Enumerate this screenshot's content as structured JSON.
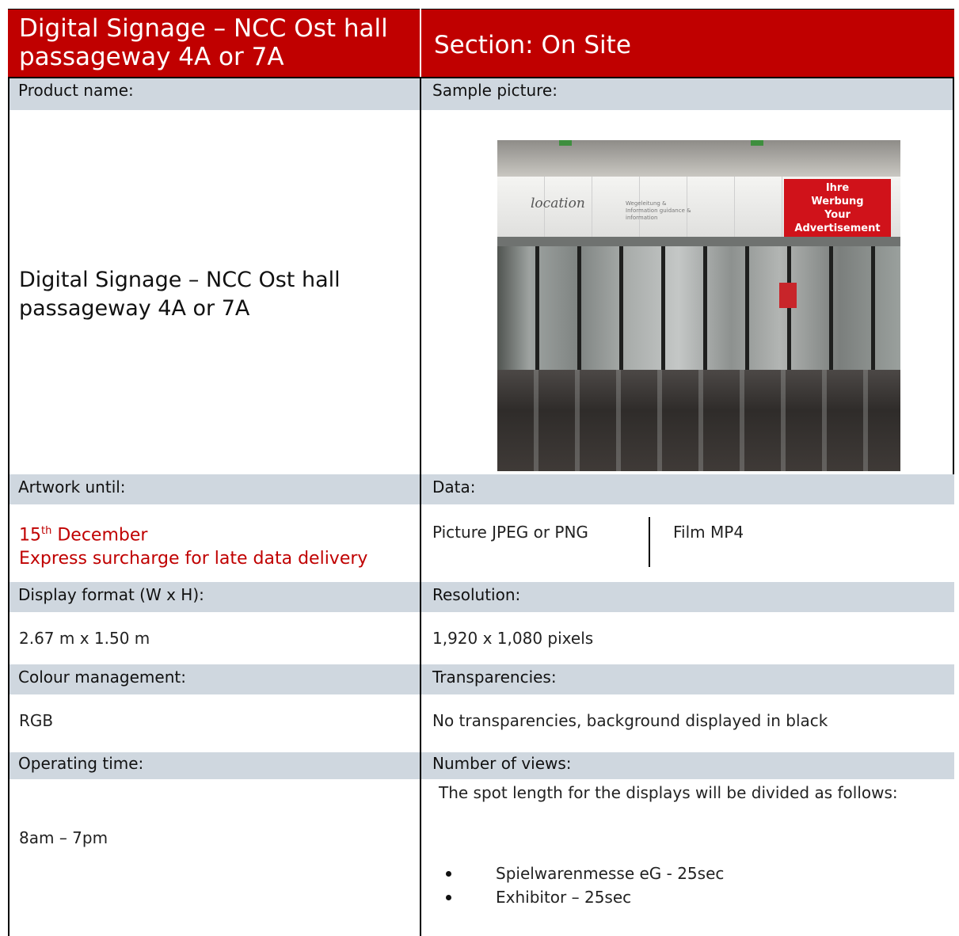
{
  "header": {
    "title": "Digital Signage – NCC Ost hall passageway 4A or 7A",
    "section": "Section: On Site"
  },
  "product": {
    "label": "Product name:",
    "value": "Digital Signage – NCC Ost hall passageway 4A or 7A"
  },
  "sample": {
    "label": "Sample picture:",
    "brand": "location",
    "brand_sub": "Wegeleitung & Information guidance & information",
    "ad_text": [
      "Ihre",
      "Werbung",
      "Your",
      "Advertisement"
    ]
  },
  "artwork": {
    "label": "Artwork until:",
    "day": "15",
    "suffix": "th",
    "month": " December",
    "note": "Express surcharge for late data delivery"
  },
  "data": {
    "label": "Data:",
    "picture": "Picture JPEG or PNG",
    "film": "Film MP4"
  },
  "display_format": {
    "label": "Display format (W x H):",
    "value": "2.67 m x 1.50 m"
  },
  "resolution": {
    "label": "Resolution:",
    "value": "1,920 x 1,080 pixels"
  },
  "colour": {
    "label": "Colour management:",
    "value": "RGB"
  },
  "transparency": {
    "label": "Transparencies:",
    "value": "No transparencies, background displayed in black"
  },
  "operating": {
    "label": "Operating time:",
    "value": "8am – 7pm"
  },
  "views": {
    "label": "Number of views:",
    "intro": "The spot length for the displays will be divided as follows:",
    "items": [
      "Spielwarenmesse eG - 25sec",
      "Exhibitor – 25sec"
    ]
  },
  "colors": {
    "accent": "#c00000",
    "label_band": "#cfd7df"
  }
}
